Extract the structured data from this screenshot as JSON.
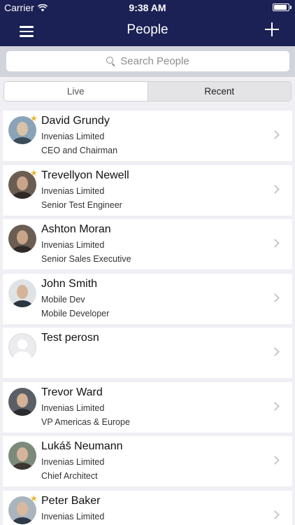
{
  "status": {
    "carrier": "Carrier",
    "time": "9:38 AM",
    "battery_level": 0.95
  },
  "nav": {
    "title": "People"
  },
  "search": {
    "placeholder": "Search People"
  },
  "segments": {
    "live": "Live",
    "recent": "Recent",
    "selected": "Recent"
  },
  "people": [
    {
      "name": "David Grundy",
      "company": "Invenias Limited",
      "role": "CEO and Chairman",
      "starred": true
    },
    {
      "name": "Trevellyon Newell",
      "company": "Invenias Limited",
      "role": "Senior Test Engineer",
      "starred": true
    },
    {
      "name": "Ashton Moran",
      "company": "Invenias Limited",
      "role": "Senior Sales Executive",
      "starred": false
    },
    {
      "name": "John Smith",
      "company": "Mobile Dev",
      "role": "Mobile Developer",
      "starred": false
    },
    {
      "name": "Test perosn",
      "company": "",
      "role": "",
      "starred": false
    },
    {
      "name": "Trevor Ward",
      "company": "Invenias Limited",
      "role": "VP Americas & Europe",
      "starred": false
    },
    {
      "name": "Lukáš Neumann",
      "company": "Invenias Limited",
      "role": "Chief Architect",
      "starred": false
    },
    {
      "name": "Peter Baker",
      "company": "Invenias Limited",
      "role": "",
      "starred": true
    }
  ],
  "colors": {
    "navbar": "#1b2155",
    "star": "#e6b830"
  }
}
